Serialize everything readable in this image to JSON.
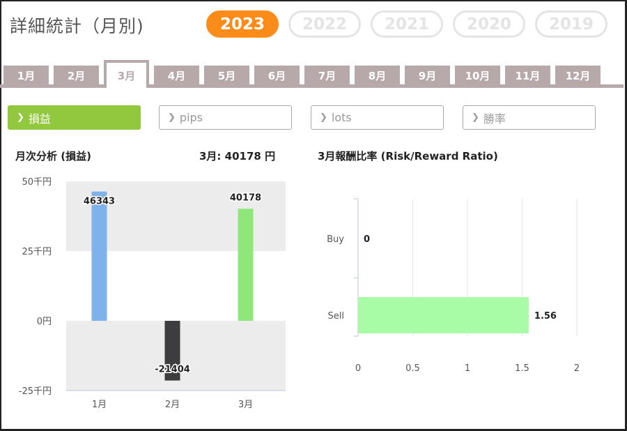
{
  "page": {
    "title": "詳細統計（月別)"
  },
  "years": [
    {
      "label": "2023",
      "active": true
    },
    {
      "label": "2022",
      "active": false
    },
    {
      "label": "2021",
      "active": false
    },
    {
      "label": "2020",
      "active": false
    },
    {
      "label": "2019",
      "active": false
    }
  ],
  "months": [
    "1月",
    "2月",
    "3月",
    "4月",
    "5月",
    "6月",
    "7月",
    "8月",
    "9月",
    "10月",
    "11月",
    "12月"
  ],
  "active_month_index": 2,
  "metrics": [
    {
      "label": "損益",
      "active": true
    },
    {
      "label": "pips",
      "active": false
    },
    {
      "label": "lots",
      "active": false
    },
    {
      "label": "勝率",
      "active": false
    }
  ],
  "colors": {
    "accent": "#fb8c1a",
    "metric_active": "#92c83e",
    "tab": "#b7a9a9",
    "bar_jan": "#7fb2ea",
    "bar_feb": "#3d3d40",
    "bar_mar": "#8fe77c",
    "ratio_bar": "#a9fca6"
  },
  "left_header": {
    "title": "月次分析 (損益)",
    "summary": "3月:  40178 円"
  },
  "right_header": {
    "title": "3月報酬比率 (Risk/Reward Ratio)"
  },
  "chart_data": [
    {
      "type": "bar",
      "title": "月次分析 (損益)",
      "categories": [
        "1月",
        "2月",
        "3月"
      ],
      "values": [
        46343,
        -21404,
        40178
      ],
      "data_labels": [
        "46343",
        "-21404",
        "40178"
      ],
      "y_ticks": [
        {
          "value": 50000,
          "label": "50千円"
        },
        {
          "value": 25000,
          "label": "25千円"
        },
        {
          "value": 0,
          "label": "0円"
        },
        {
          "value": -25000,
          "label": "-25千円"
        }
      ],
      "ylim": [
        -25000,
        50000
      ],
      "grid": "alternating bands"
    },
    {
      "type": "bar",
      "orientation": "horizontal",
      "title": "3月報酬比率 (Risk/Reward Ratio)",
      "categories": [
        "Buy",
        "Sell"
      ],
      "values": [
        0,
        1.56
      ],
      "data_labels": [
        "0",
        "1.56"
      ],
      "x_ticks": [
        "0",
        "0.5",
        "1",
        "1.5",
        "2"
      ],
      "xlim": [
        0,
        2
      ],
      "grid": true
    }
  ]
}
